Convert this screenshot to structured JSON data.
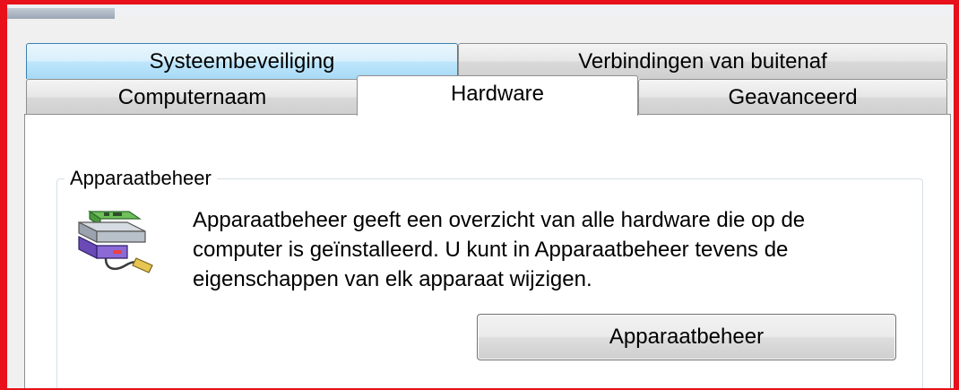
{
  "tabs_row_back": [
    {
      "label": "Systeembeveiliging",
      "state": "hover"
    },
    {
      "label": "Verbindingen van buitenaf",
      "state": "normal"
    }
  ],
  "tabs_row_front": [
    {
      "label": "Computernaam",
      "state": "normal"
    },
    {
      "label": "Hardware",
      "state": "selected"
    },
    {
      "label": "Geavanceerd",
      "state": "normal"
    }
  ],
  "device_manager": {
    "group_title": "Apparaatbeheer",
    "icon": "device-manager-icon",
    "description_lines": [
      "Apparaatbeheer geeft een overzicht van alle hardware die op de",
      "computer is geïnstalleerd. U kunt in Apparaatbeheer tevens de",
      "eigenschappen van elk apparaat wijzigen."
    ],
    "button_label": "Apparaatbeheer"
  },
  "colors": {
    "highlight_frame": "#e8101a",
    "hover_tab": "#bee6fd",
    "panel_background": "#ffffff"
  }
}
